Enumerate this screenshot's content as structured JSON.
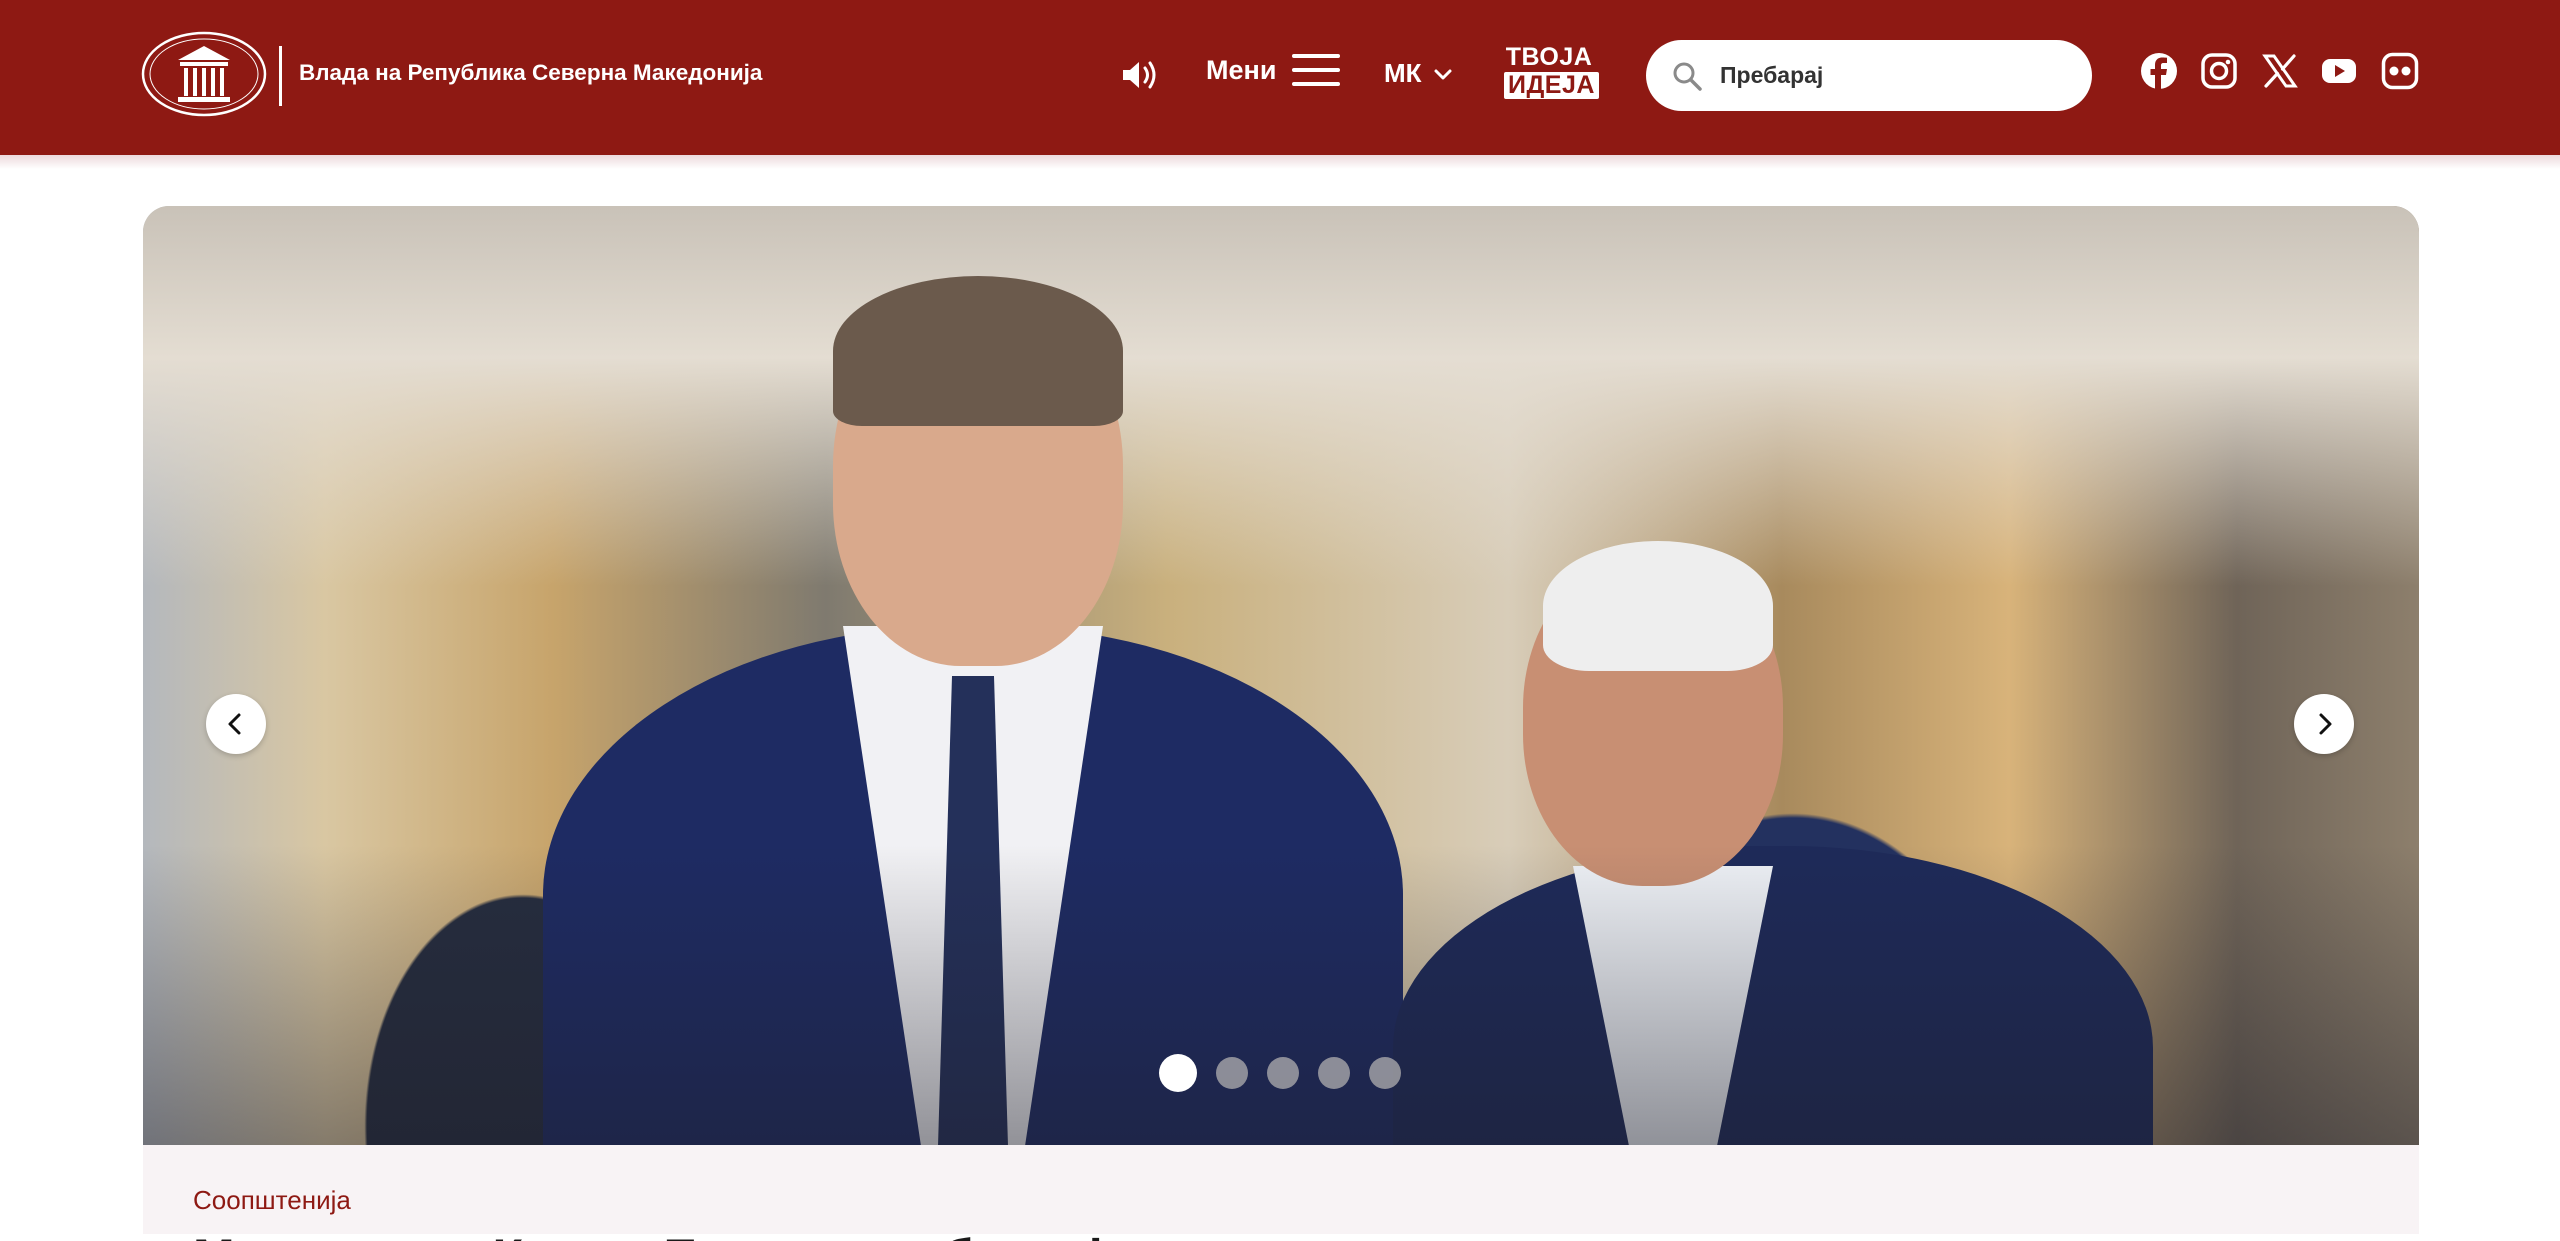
{
  "header": {
    "brand_name": "Влада на Република Северна Македонија",
    "logo_icon": "government-emblem-icon",
    "speaker_icon": "speaker-icon",
    "menu_label": "Мени",
    "menu_icon": "hamburger-icon",
    "language_label": "МК",
    "language_icon": "chevron-down-icon",
    "idea_top": "ТВОЈА",
    "idea_bottom": "ИДЕЈА",
    "search_placeholder": "Пребарај",
    "search_icon": "search-icon",
    "social": [
      "facebook-icon",
      "instagram-icon",
      "x-icon",
      "youtube-icon",
      "flickr-icon"
    ]
  },
  "hero": {
    "prev_icon": "chevron-left-icon",
    "next_icon": "chevron-right-icon",
    "slide_count": 5,
    "active_slide": 1
  },
  "news": {
    "category": "Соопштенија",
    "title": "Мицкоски и Коста: Европа треба да ја исполни ветувањата кон Македонија"
  },
  "colors": {
    "brand": "#8e1913",
    "panel": "#f8f3f5"
  }
}
